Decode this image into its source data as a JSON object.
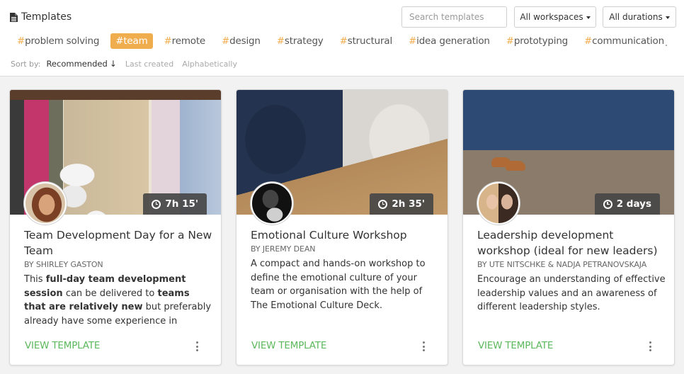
{
  "header": {
    "title": "Templates",
    "title_icon": "document-icon",
    "search": {
      "placeholder": "Search templates",
      "value": ""
    },
    "workspaces_dropdown": {
      "label": "All workspaces",
      "icon": "caret-down-icon"
    },
    "durations_dropdown": {
      "label": "All durations",
      "icon": "caret-down-icon"
    }
  },
  "tags": [
    {
      "label": "problem solving",
      "active": false
    },
    {
      "label": "team",
      "active": true
    },
    {
      "label": "remote",
      "active": false
    },
    {
      "label": "design",
      "active": false
    },
    {
      "label": "strategy",
      "active": false
    },
    {
      "label": "structural",
      "active": false
    },
    {
      "label": "idea generation",
      "active": false
    },
    {
      "label": "prototyping",
      "active": false
    },
    {
      "label": "communication",
      "active": false
    }
  ],
  "tag_prefix": "#",
  "sort": {
    "label": "Sort by:",
    "options": [
      {
        "label": "Recommended",
        "active": true,
        "icon": "arrow-down-icon",
        "icon_glyph": "↓"
      },
      {
        "label": "Last created",
        "active": false
      },
      {
        "label": "Alphabetically",
        "active": false
      }
    ]
  },
  "colors": {
    "accent_tag": "#f0ad4e",
    "link_green": "#5cb85c",
    "badge_bg": "#464646"
  },
  "cards": [
    {
      "title": "Team Development Day for a New Team",
      "author": "BY SHIRLEY GASTON",
      "duration": "7h 15'",
      "description_parts": [
        {
          "text": "This ",
          "bold": false
        },
        {
          "text": "full-day team development session",
          "bold": true
        },
        {
          "text": " can be delivered to ",
          "bold": false
        },
        {
          "text": "teams that are relatively new",
          "bold": true
        },
        {
          "text": " but preferably already have some experience in",
          "bold": false
        }
      ],
      "link": "VIEW TEMPLATE"
    },
    {
      "title": "Emotional Culture Workshop",
      "author": "BY JEREMY DEAN",
      "duration": "2h 35'",
      "description_parts": [
        {
          "text": "A compact and hands-on workshop to define the emotional culture of your team or organisation with the help of The Emotional Culture Deck.",
          "bold": false
        }
      ],
      "link": "VIEW TEMPLATE"
    },
    {
      "title": "Leadership development workshop (ideal for new leaders)",
      "author": "BY UTE NITSCHKE & NADJA PETRANOVSKAJA",
      "duration": "2 days",
      "description_parts": [
        {
          "text": "Encourage an understanding of effective leadership values and an awareness of different leadership styles.",
          "bold": false
        }
      ],
      "link": "VIEW TEMPLATE"
    }
  ]
}
